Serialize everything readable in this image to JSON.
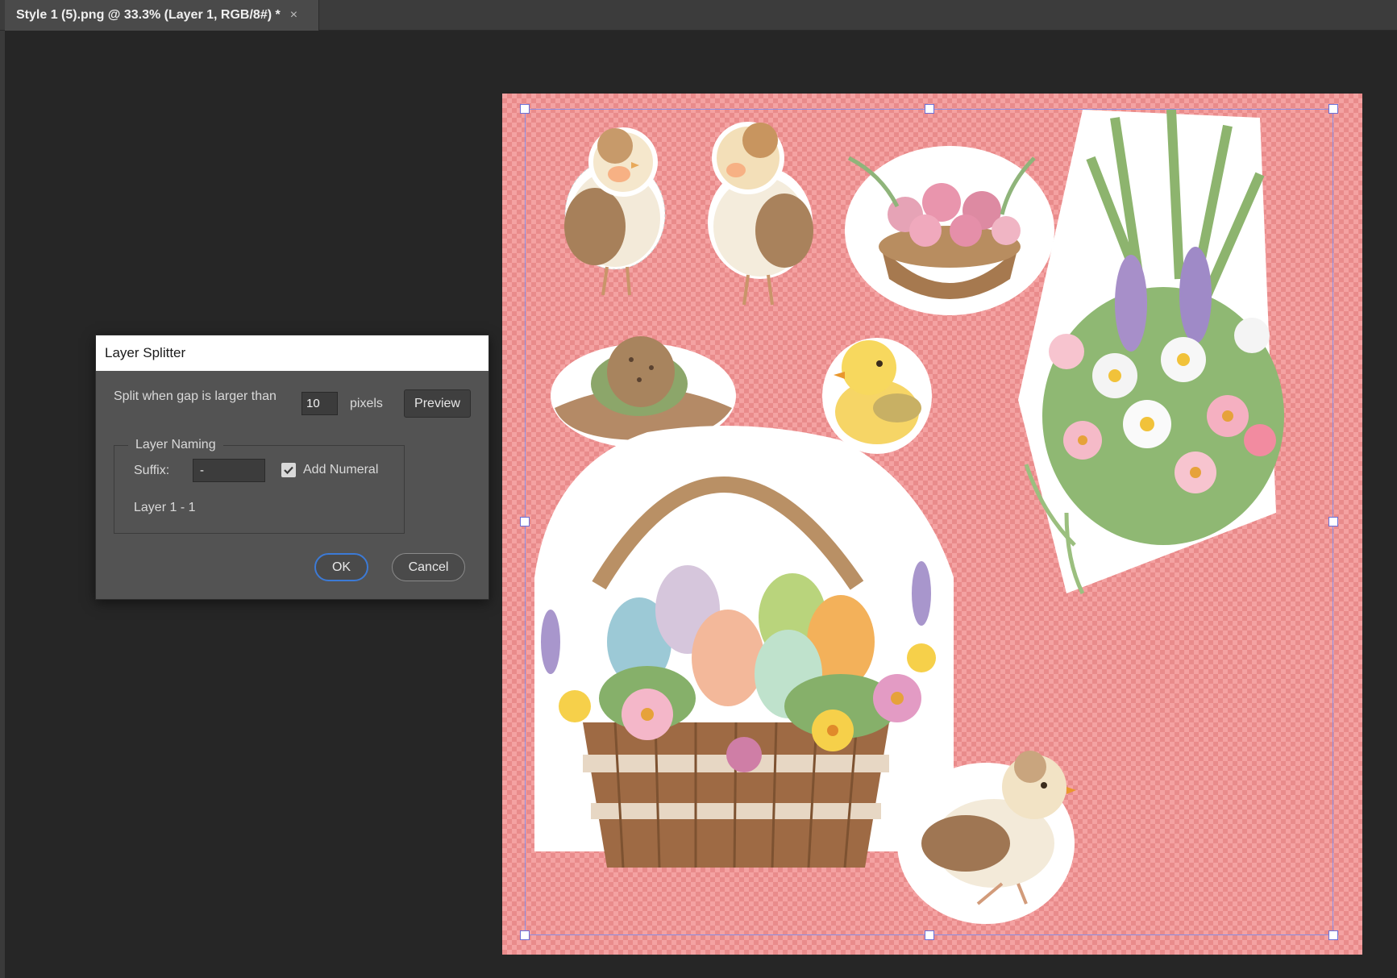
{
  "document": {
    "tab_title": "Style 1 (5).png @ 33.3% (Layer 1, RGB/8#) *",
    "close_glyph": "×"
  },
  "dialog": {
    "title": "Layer Splitter",
    "gap_label": "Split when gap is larger than",
    "gap_value": "10",
    "gap_unit": "pixels",
    "preview_button": "Preview",
    "naming_group_title": "Layer Naming",
    "suffix_label": "Suffix:",
    "suffix_value": "-",
    "add_numeral_label": "Add Numeral",
    "add_numeral_checked": true,
    "name_preview": "Layer 1 - 1",
    "ok_button": "OK",
    "cancel_button": "Cancel"
  },
  "canvas": {
    "artwork": [
      "chick-sticker",
      "chick-sticker",
      "flower-basket-sticker",
      "nest-egg-sticker",
      "yellow-chick-sticker",
      "flower-bouquet-sticker",
      "easter-egg-basket-sticker",
      "sitting-chick-sticker"
    ],
    "colors": {
      "transparency_light": "#f4a2a2",
      "transparency_dark": "#e98b8b",
      "selection_box": "#8c8ee3",
      "ok_focus": "#3c7ad6"
    }
  }
}
